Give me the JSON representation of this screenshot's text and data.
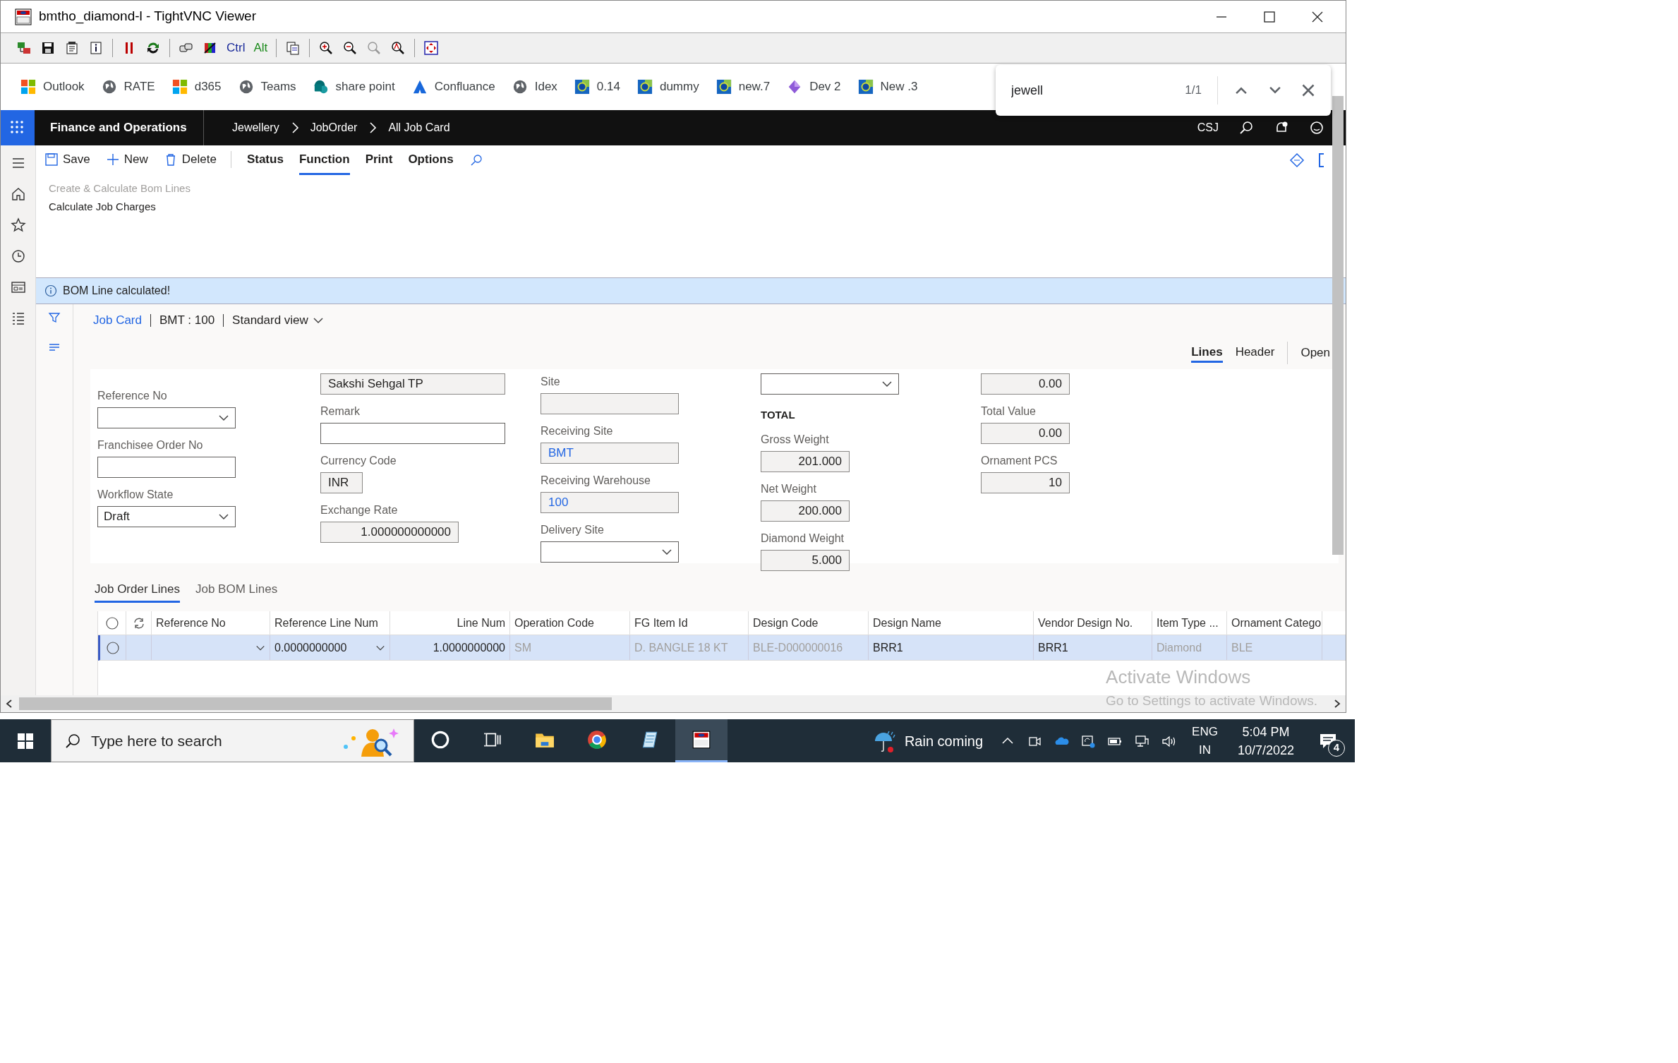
{
  "window": {
    "title": "bmtho_diamond-l - TightVNC Viewer"
  },
  "vnc_toolbar": {
    "keys": [
      "Ctrl",
      "Alt"
    ]
  },
  "bookmarks": [
    {
      "label": "Outlook",
      "kind": "windows"
    },
    {
      "label": "RATE",
      "kind": "globe"
    },
    {
      "label": "d365",
      "kind": "windows"
    },
    {
      "label": "Teams",
      "kind": "globe"
    },
    {
      "label": "share point",
      "kind": "sharepoint"
    },
    {
      "label": "Confluance",
      "kind": "atlassian"
    },
    {
      "label": "Idex",
      "kind": "globe"
    },
    {
      "label": "0.14",
      "kind": "tile"
    },
    {
      "label": "dummy",
      "kind": "tile"
    },
    {
      "label": "new.7",
      "kind": "tile"
    },
    {
      "label": "Dev 2",
      "kind": "diamond"
    },
    {
      "label": "New .3",
      "kind": "tile"
    }
  ],
  "find_bar": {
    "query": "jewell",
    "count": "1/1"
  },
  "app_bar": {
    "title": "Finance and Operations",
    "breadcrumbs": [
      "Jewellery",
      "JobOrder",
      "All Job Card"
    ],
    "user": "CSJ"
  },
  "actions": [
    {
      "label": "Save",
      "kind": "save",
      "selected": false
    },
    {
      "label": "New",
      "kind": "new",
      "selected": false
    },
    {
      "label": "Delete",
      "kind": "delete",
      "selected": false
    },
    {
      "label": "Status",
      "kind": "menu",
      "selected": false
    },
    {
      "label": "Function",
      "kind": "menu",
      "selected": true
    },
    {
      "label": "Print",
      "kind": "menu",
      "selected": false
    },
    {
      "label": "Options",
      "kind": "menu",
      "selected": false
    }
  ],
  "function_menu": [
    {
      "label": "Create & Calculate Bom Lines",
      "disabled": true
    },
    {
      "label": "Calculate Job Charges",
      "disabled": false
    }
  ],
  "message": "BOM Line calculated!",
  "header": {
    "link": "Job Card",
    "record": "BMT : 100",
    "view": "Standard view"
  },
  "view_tabs": [
    {
      "label": "Lines",
      "selected": true
    },
    {
      "label": "Header",
      "selected": false
    }
  ],
  "open_button": "Open",
  "form_columns": [
    [
      {
        "kind": "dropdown",
        "label": "Reference No"
      },
      {
        "kind": "input",
        "label": "Franchisee Order No"
      },
      {
        "kind": "dropdown",
        "label": "Workflow State",
        "value": "Draft"
      }
    ],
    [
      {
        "kind": "readonly",
        "value": "Sakshi Sehgal TP"
      },
      {
        "kind": "input",
        "label": "Remark"
      },
      {
        "kind": "readonly",
        "label": "Currency Code",
        "value": "INR"
      },
      {
        "kind": "readonly",
        "label": "Exchange Rate",
        "value": "1.000000000000"
      }
    ],
    [
      {
        "kind": "readonly",
        "label": "Site"
      },
      {
        "kind": "readonly",
        "label": "Receiving Site",
        "value": "BMT",
        "linked": true
      },
      {
        "kind": "readonly",
        "label": "Receiving Warehouse",
        "value": "100",
        "linked": true
      },
      {
        "kind": "dropdown",
        "label": "Delivery Site"
      }
    ],
    [
      {
        "kind": "dropdown"
      },
      {
        "kind": "heading",
        "label": "TOTAL"
      },
      {
        "kind": "readonly",
        "label": "Gross Weight",
        "value": "201.000"
      },
      {
        "kind": "readonly",
        "label": "Net Weight",
        "value": "200.000"
      },
      {
        "kind": "readonly",
        "label": "Diamond Weight",
        "value": "5.000"
      }
    ],
    [
      {
        "kind": "readonly",
        "value": "0.00"
      },
      {
        "kind": "readonly",
        "label": "Total Value",
        "value": "0.00"
      },
      {
        "kind": "readonly",
        "label": "Ornament PCS",
        "value": "10"
      }
    ]
  ],
  "line_tabs": [
    {
      "label": "Job Order Lines",
      "selected": true
    },
    {
      "label": "Job BOM Lines",
      "selected": false
    }
  ],
  "grid": {
    "columns": [
      "Reference No",
      "Reference Line Num",
      "Line Num",
      "Operation Code",
      "FG Item Id",
      "Design Code",
      "Design Name",
      "Vendor Design No.",
      "Item Type ...",
      "Ornament Catego"
    ],
    "all_checked": false,
    "rows": [
      {
        "selected": true,
        "checked": false,
        "cells": [
          {
            "dropdown": true
          },
          {
            "text": "0.0000000000",
            "dropdown": true,
            "disabled": false
          },
          {
            "text": "1.0000000000",
            "dropdown": false,
            "disabled": false
          },
          {
            "text": "SM",
            "dropdown": false,
            "disabled": true
          },
          {
            "text": "D. BANGLE 18 KT",
            "dropdown": false,
            "disabled": true
          },
          {
            "text": "BLE-D000000016",
            "dropdown": false,
            "disabled": true
          },
          {
            "text": "BRR1",
            "dropdown": false,
            "disabled": false
          },
          {
            "text": "BRR1",
            "dropdown": false,
            "disabled": false
          },
          {
            "text": "Diamond",
            "dropdown": false,
            "disabled": true
          },
          {
            "text": "BLE",
            "dropdown": false,
            "disabled": true
          }
        ]
      }
    ]
  },
  "activation_notice": {
    "title": "Activate Windows",
    "subtitle": "Go to Settings to activate Windows."
  },
  "taskbar": {
    "search_placeholder": "Type here to search",
    "apps": [
      {
        "kind": "cortana",
        "active": false
      },
      {
        "kind": "taskview",
        "active": false
      },
      {
        "kind": "folder",
        "active": false
      },
      {
        "kind": "chrome",
        "active": false
      },
      {
        "kind": "notepad",
        "active": false
      },
      {
        "kind": "vnc",
        "active": true
      }
    ],
    "weather": "Rain coming",
    "language": [
      "ENG",
      "IN"
    ],
    "time": "5:04 PM",
    "date": "10/7/2022",
    "notifications": "4"
  }
}
